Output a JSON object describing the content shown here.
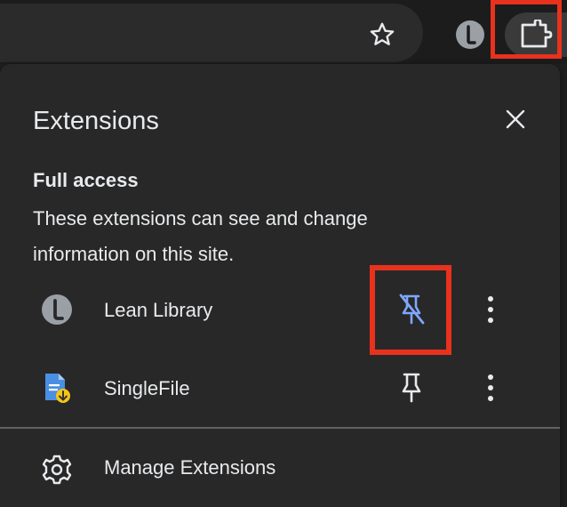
{
  "toolbar": {
    "star_icon": "star-icon",
    "lean_library_icon": "lean-library-icon",
    "extensions_icon": "puzzle-icon"
  },
  "panel": {
    "title": "Extensions",
    "close_icon": "close-icon",
    "section_heading": "Full access",
    "section_description": "These extensions can see and change information on this site.",
    "extensions": [
      {
        "name": "Lean Library",
        "icon": "lean-library-icon",
        "pinned": true,
        "pin_icon": "unpin-icon",
        "pin_color": "#7ea7ff"
      },
      {
        "name": "SingleFile",
        "icon": "singlefile-icon",
        "pinned": false,
        "pin_icon": "pin-icon",
        "pin_color": "#e8eaed"
      }
    ],
    "manage_label": "Manage Extensions",
    "manage_icon": "gear-icon"
  },
  "colors": {
    "highlight": "#e8321d",
    "panel_bg": "#282828",
    "text": "#e8eaed",
    "pinned_accent": "#7ea7ff"
  }
}
